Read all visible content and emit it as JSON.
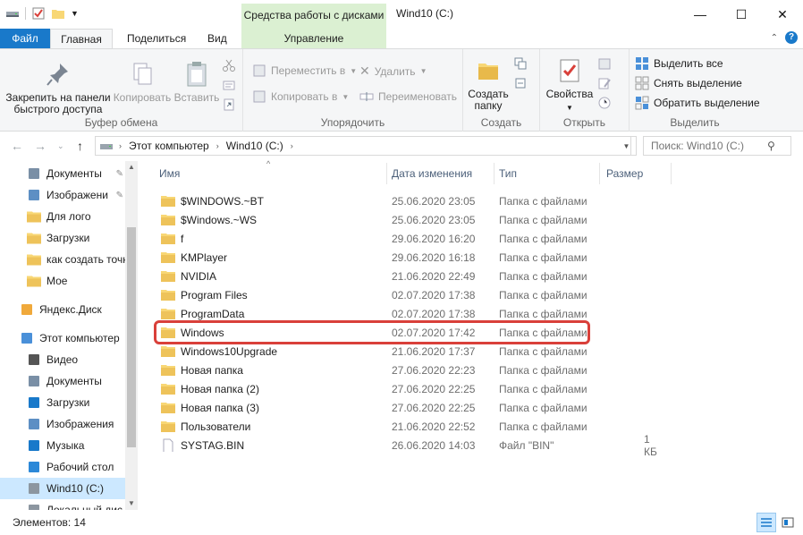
{
  "window": {
    "title": "Wind10 (C:)",
    "context_group": "Средства работы с дисками",
    "context_tab": "Управление",
    "minimize": "—",
    "maximize": "☐",
    "close": "✕"
  },
  "tabs": {
    "file": "Файл",
    "home": "Главная",
    "share": "Поделиться",
    "view": "Вид"
  },
  "ribbon": {
    "clipboard": {
      "label": "Буфер обмена",
      "pin": "Закрепить на панели быстрого доступа",
      "copy": "Копировать",
      "paste": "Вставить"
    },
    "organize": {
      "label": "Упорядочить",
      "move_to": "Переместить в",
      "copy_to": "Копировать в",
      "delete": "Удалить",
      "rename": "Переименовать"
    },
    "create": {
      "label": "Создать",
      "new_folder": "Создать папку"
    },
    "open": {
      "label": "Открыть",
      "properties": "Свойства"
    },
    "select": {
      "label": "Выделить",
      "select_all": "Выделить все",
      "select_none": "Снять выделение",
      "invert": "Обратить выделение"
    }
  },
  "address": {
    "segments": [
      "Этот компьютер",
      "Wind10 (C:)"
    ],
    "search_placeholder": "Поиск: Wind10 (C:)"
  },
  "navpane": {
    "quick": [
      {
        "label": "Документы",
        "pinned": true
      },
      {
        "label": "Изображени",
        "pinned": true
      },
      {
        "label": "Для лого",
        "pinned": false
      },
      {
        "label": "Загрузки",
        "pinned": false
      },
      {
        "label": "как создать точк",
        "pinned": false
      },
      {
        "label": "Мое",
        "pinned": false
      }
    ],
    "yandex": "Яндекс.Диск",
    "this_pc": "Этот компьютер",
    "pc_items": [
      "Видео",
      "Документы",
      "Загрузки",
      "Изображения",
      "Музыка",
      "Рабочий стол",
      "Wind10 (C:)",
      "Локальный дис"
    ]
  },
  "columns": {
    "name": "Имя",
    "date": "Дата изменения",
    "type": "Тип",
    "size": "Размер"
  },
  "files": [
    {
      "name": "$WINDOWS.~BT",
      "date": "25.06.2020 23:05",
      "type": "Папка с файлами",
      "size": ""
    },
    {
      "name": "$Windows.~WS",
      "date": "25.06.2020 23:05",
      "type": "Папка с файлами",
      "size": ""
    },
    {
      "name": "f",
      "date": "29.06.2020 16:20",
      "type": "Папка с файлами",
      "size": ""
    },
    {
      "name": "KMPlayer",
      "date": "29.06.2020 16:18",
      "type": "Папка с файлами",
      "size": ""
    },
    {
      "name": "NVIDIA",
      "date": "21.06.2020 22:49",
      "type": "Папка с файлами",
      "size": ""
    },
    {
      "name": "Program Files",
      "date": "02.07.2020 17:38",
      "type": "Папка с файлами",
      "size": ""
    },
    {
      "name": "ProgramData",
      "date": "02.07.2020 17:38",
      "type": "Папка с файлами",
      "size": ""
    },
    {
      "name": "Windows",
      "date": "02.07.2020 17:42",
      "type": "Папка с файлами",
      "size": ""
    },
    {
      "name": "Windows10Upgrade",
      "date": "21.06.2020 17:37",
      "type": "Папка с файлами",
      "size": ""
    },
    {
      "name": "Новая папка",
      "date": "27.06.2020 22:23",
      "type": "Папка с файлами",
      "size": ""
    },
    {
      "name": "Новая папка (2)",
      "date": "27.06.2020 22:25",
      "type": "Папка с файлами",
      "size": ""
    },
    {
      "name": "Новая папка (3)",
      "date": "27.06.2020 22:25",
      "type": "Папка с файлами",
      "size": ""
    },
    {
      "name": "Пользователи",
      "date": "21.06.2020 22:52",
      "type": "Папка с файлами",
      "size": ""
    },
    {
      "name": "SYSTAG.BIN",
      "date": "26.06.2020 14:03",
      "type": "Файл \"BIN\"",
      "size": "1 КБ"
    }
  ],
  "status": {
    "items_count": "Элементов: 14"
  },
  "colors": {
    "accent": "#1979ca",
    "folder": "#f8d775",
    "highlight": "#d9403a",
    "context": "#dbf0d2"
  }
}
